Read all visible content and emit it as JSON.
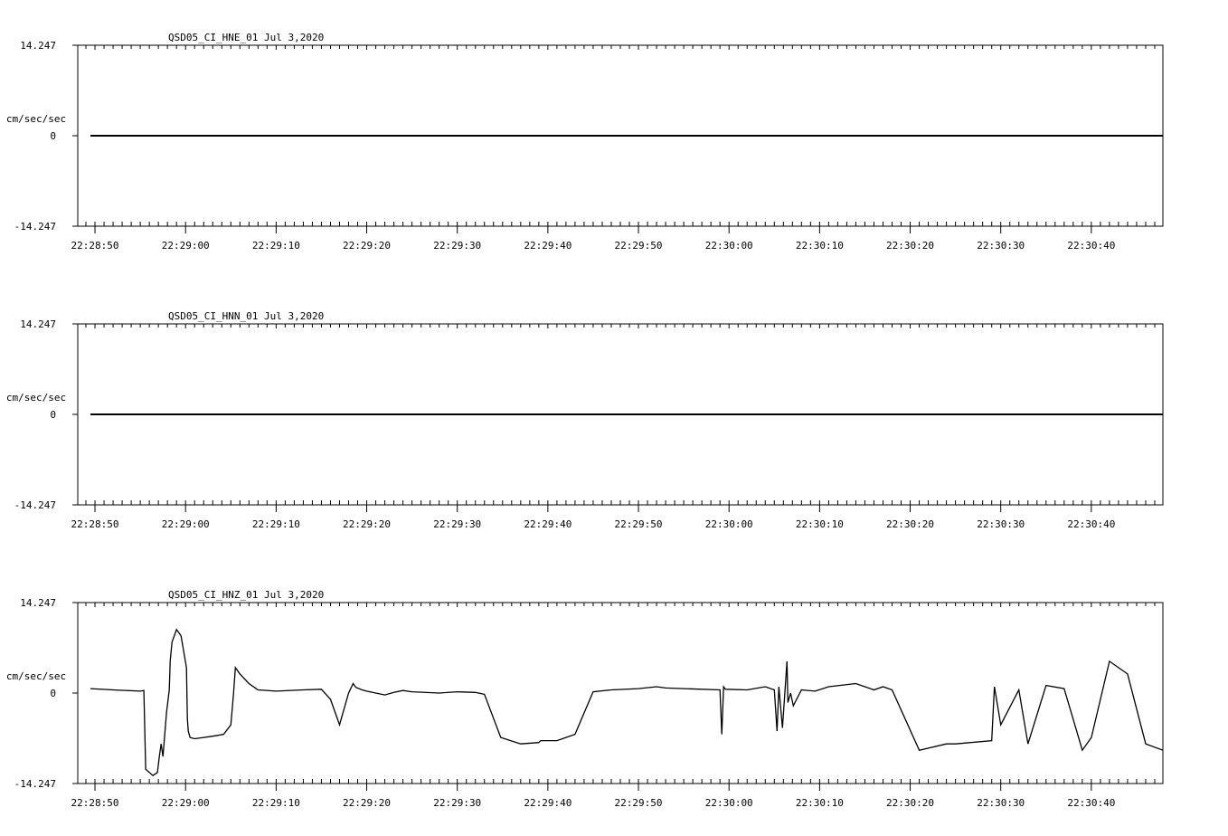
{
  "chart_data": [
    {
      "type": "line",
      "title": "QSD05_CI_HNE_01  Jul 3,2020",
      "ylabel": "cm/sec/sec",
      "ylim": [
        -14.247,
        14.247
      ],
      "y_tick_labels": [
        "14.247",
        "0",
        "-14.247"
      ],
      "x_tick_labels": [
        "22:28:50",
        "22:29:00",
        "22:29:10",
        "22:29:20",
        "22:29:30",
        "22:29:40",
        "22:29:50",
        "22:30:00",
        "22:30:10",
        "22:30:20",
        "22:30:30",
        "22:30:40"
      ],
      "xlim_seconds": [
        -1.9,
        117.9
      ],
      "x_seconds": [
        -0.5,
        117.9
      ],
      "y": [
        0,
        0
      ],
      "grid": false
    },
    {
      "type": "line",
      "title": "QSD05_CI_HNN_01  Jul 3,2020",
      "ylabel": "cm/sec/sec",
      "ylim": [
        -14.247,
        14.247
      ],
      "y_tick_labels": [
        "14.247",
        "0",
        "-14.247"
      ],
      "x_tick_labels": [
        "22:28:50",
        "22:29:00",
        "22:29:10",
        "22:29:20",
        "22:29:30",
        "22:29:40",
        "22:29:50",
        "22:30:00",
        "22:30:10",
        "22:30:20",
        "22:30:30",
        "22:30:40"
      ],
      "xlim_seconds": [
        -1.9,
        117.9
      ],
      "x_seconds": [
        -0.5,
        117.9
      ],
      "y": [
        0,
        0
      ],
      "grid": false
    },
    {
      "type": "line",
      "title": "QSD05_CI_HNZ_01  Jul 3,2020",
      "ylabel": "cm/sec/sec",
      "ylim": [
        -14.247,
        14.247
      ],
      "y_tick_labels": [
        "14.247",
        "0",
        "-14.247"
      ],
      "x_tick_labels": [
        "22:28:50",
        "22:29:00",
        "22:29:10",
        "22:29:20",
        "22:29:30",
        "22:29:40",
        "22:29:50",
        "22:30:00",
        "22:30:10",
        "22:30:20",
        "22:30:30",
        "22:30:40"
      ],
      "xlim_seconds": [
        -1.9,
        117.9
      ],
      "x_seconds": [
        -0.5,
        2,
        5,
        5.4,
        5.6,
        6.4,
        6.9,
        7.1,
        7.3,
        7.5,
        7.9,
        8.2,
        8.3,
        8.5,
        9.0,
        9.5,
        10.1,
        10.2,
        10.3,
        10.5,
        11,
        12,
        13,
        14.2,
        15.0,
        15.3,
        15.5,
        16,
        17,
        18,
        20,
        23,
        25,
        26,
        27,
        28.0,
        28.5,
        28.8,
        29.5,
        30,
        31,
        32,
        33,
        34,
        35,
        38,
        40,
        42,
        43,
        44.8,
        47,
        49,
        49.2,
        51,
        52,
        53,
        55,
        57,
        60,
        62,
        63,
        69,
        69.2,
        69.4,
        69.6,
        72,
        74,
        75,
        75.3,
        75.5,
        75.9,
        76.4,
        76.5,
        76.8,
        77.1,
        78,
        79.5,
        81,
        84,
        86,
        87,
        88,
        91,
        94,
        95,
        99,
        99.3,
        100,
        102,
        103,
        105,
        107,
        109,
        110,
        112,
        114,
        116,
        117.9
      ],
      "y": [
        0.7,
        0.5,
        0.3,
        0.4,
        -12,
        -13,
        -12.5,
        -10,
        -8,
        -10,
        -3,
        0.5,
        5,
        8,
        10,
        9,
        4,
        -4,
        -6,
        -7,
        -7.2,
        -7.0,
        -6.8,
        -6.5,
        -5,
        0,
        4,
        3,
        1.5,
        0.5,
        0.3,
        0.5,
        0.6,
        -1,
        -5,
        0,
        1.5,
        0.9,
        0.5,
        0.3,
        0,
        -0.3,
        0.1,
        0.4,
        0.2,
        0.0,
        0.2,
        0.1,
        -0.2,
        -7,
        -8,
        -7.8,
        -7.5,
        -7.5,
        -7.0,
        -6.5,
        0.2,
        0.5,
        0.7,
        1.0,
        0.8,
        0.5,
        -6.5,
        1.0,
        0.6,
        0.5,
        1.0,
        0.5,
        -6,
        1.0,
        -5.5,
        5,
        -1.5,
        0.0,
        -2,
        0.5,
        0.3,
        1.0,
        1.5,
        0.5,
        1.0,
        0.5,
        -9,
        -8,
        -8,
        -7.5,
        1.0,
        -5,
        0.5,
        -8,
        1.2,
        0.7,
        -9,
        -7,
        5,
        3,
        -8,
        -9,
        -8.5,
        -7,
        -5
      ]
    }
  ]
}
